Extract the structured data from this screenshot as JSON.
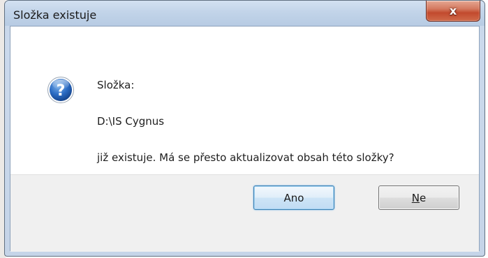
{
  "window": {
    "title": "Složka existuje"
  },
  "titlebar": {
    "close_glyph": "x"
  },
  "icon": {
    "name": "question-icon",
    "glyph": "?"
  },
  "message": {
    "folder_label": "Složka:",
    "path": "D:\\IS Cygnus",
    "question": "již existuje. Má se přesto aktualizovat obsah této složky?"
  },
  "buttons": {
    "yes_label": "Ano",
    "no_accel": "N",
    "no_rest": "e"
  },
  "colors": {
    "titlebar": "#c2d4e9",
    "close_button": "#c24a2e",
    "default_button_border": "#3c7fb1",
    "button_area": "#f0f0f0",
    "icon_blue": "#1f5fb0"
  }
}
